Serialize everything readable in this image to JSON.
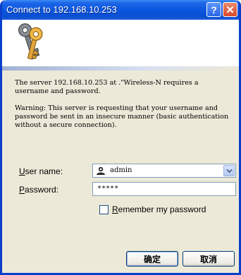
{
  "window": {
    "title": "Connect to 192.168.10.253",
    "help_symbol": "?",
    "close_symbol": "✕"
  },
  "message": {
    "intro": "The server 192.168.10.253 at .\"Wireless-N requires a username and password.",
    "warning": "Warning: This server is requesting that your username and password be sent in an insecure manner (basic authentication without a secure connection)."
  },
  "form": {
    "user_label_first": "U",
    "user_label_rest": "ser name:",
    "username": "admin",
    "password_label_first": "P",
    "password_label_rest": "assword:",
    "password": "*****",
    "remember_label_first": "R",
    "remember_label_rest": "emember my password",
    "remember_checked": false
  },
  "buttons": {
    "ok": "确定",
    "cancel": "取消"
  },
  "colors": {
    "titlebar": "#0a55dd",
    "frame": "#0a3fcc",
    "dialog_bg": "#ece9d8",
    "close_button": "#d8492a"
  },
  "icons": {
    "banner": "keys-icon",
    "user": "user-icon",
    "dropdown": "chevron-down-icon"
  }
}
